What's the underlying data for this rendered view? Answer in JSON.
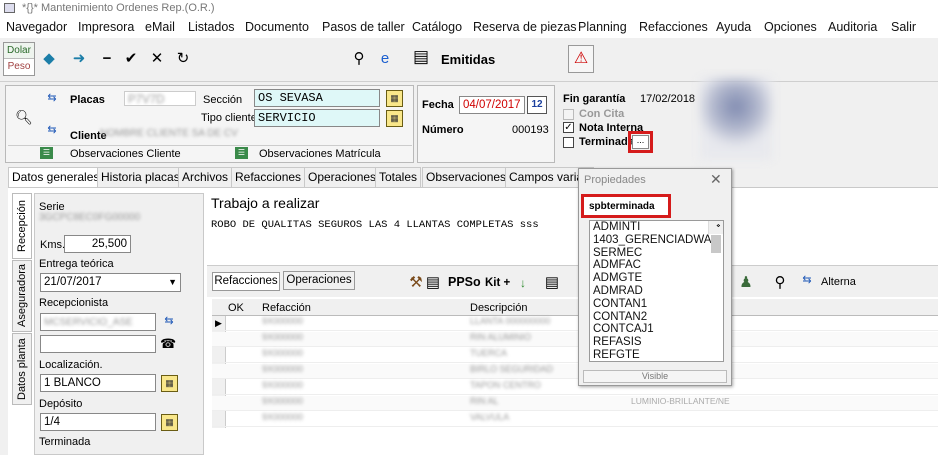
{
  "window": {
    "title": "*{}* Mantenimiento Ordenes Rep.(O.R.)"
  },
  "menu": [
    "Navegador",
    "Impresora",
    "eMail",
    "Listados",
    "Documento",
    "Pasos de taller",
    "Catálogo",
    "Reserva de piezas",
    "Planning",
    "Refacciones",
    "Ayuda",
    "Opciones",
    "Auditoria",
    "Salir"
  ],
  "currency": {
    "dolar": "Dolar",
    "peso": "Peso"
  },
  "toolbar": {
    "status_label": "Emitidas"
  },
  "header": {
    "placas_label": "Placas",
    "cliente_label": "Cliente",
    "seccion_label": "Sección",
    "seccion_value": "OS SEVASA",
    "tipo_cliente_label": "Tipo cliente",
    "tipo_cliente_value": "SERVICIO",
    "obs_cliente_label": "Observaciones  Cliente",
    "obs_matricula_label": "Observaciones  Matrícula",
    "fecha_label": "Fecha",
    "fecha_value": "04/07/2017",
    "numero_label": "Número",
    "numero_value": "000193",
    "fin_garantia_label": "Fin garantía",
    "fin_garantia_value": "17/02/2018",
    "con_cita_label": "Con Cita",
    "nota_interna_label": "Nota Interna",
    "terminada_label": "Terminada",
    "ellipsis": "..."
  },
  "tabs": [
    "Datos generales",
    "Historia placas",
    "Archivos",
    "Refacciones",
    "Operaciones",
    "Totales",
    "Observaciones",
    "Campos variab"
  ],
  "side_tabs": [
    "Recepción",
    "Aseguradora",
    "Datos planta"
  ],
  "left_form": {
    "serie_label": "Serie",
    "kms_label": "Kms.",
    "kms_value": "25,500",
    "entrega_label": "Entrega teórica",
    "entrega_value": "21/07/2017",
    "recepcionista_label": "Recepcionista",
    "localizacion_label": "Localización.",
    "localizacion_value": "1 BLANCO",
    "deposito_label": "Depósito",
    "deposito_value": "1/4",
    "terminada_label": "Terminada"
  },
  "work": {
    "title": "Trabajo a realizar",
    "text": "ROBO DE QUALITAS SEGUROS LAS 4 LLANTAS COMPLETAS  sss"
  },
  "subtabs": {
    "refacciones": "Refacciones",
    "operaciones": "Operaciones"
  },
  "grid_toolbar": {
    "ppso": "PPSo",
    "kit": "Kit +",
    "alterna": "Alterna"
  },
  "grid": {
    "headers": [
      "OK",
      "Refacción",
      "Descripción"
    ],
    "visible_text": "LUMINIO-BRILLANTE/NE"
  },
  "popup": {
    "title": "Propiedades",
    "field_name": "spbterminada",
    "items": [
      "ADMINTI",
      "1403_GERENCIADWA",
      "SERMEC",
      "ADMFAC",
      "ADMGTE",
      "ADMRAD",
      "CONTAN1",
      "CONTAN2",
      "CONTCAJ1",
      "REFASIS",
      "REFGTE"
    ],
    "footer": "Visible"
  },
  "colors": {
    "highlight_red": "#d51b1b",
    "cyan_field": "#dff8f8",
    "date_red": "#d00000"
  }
}
